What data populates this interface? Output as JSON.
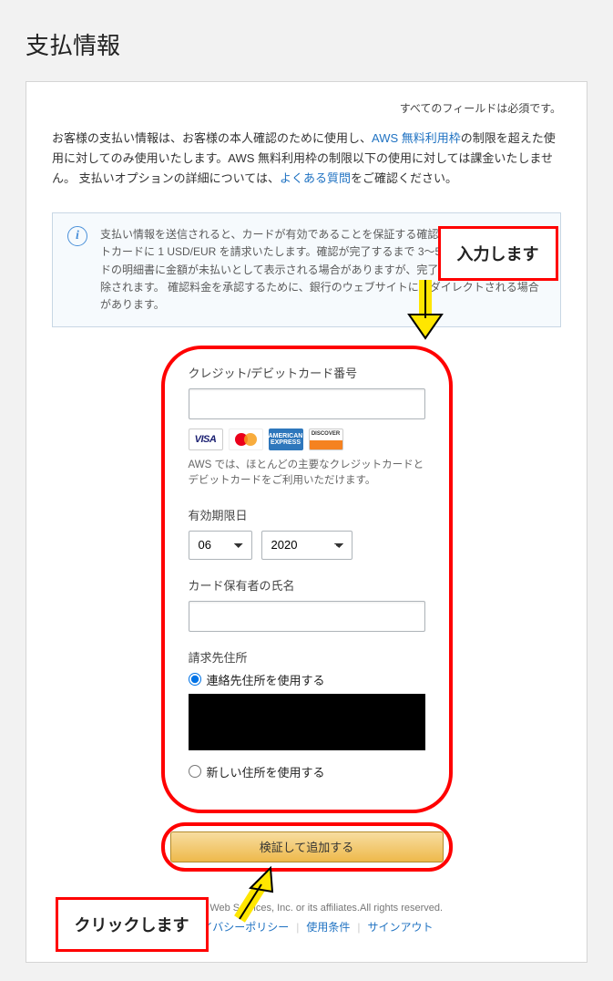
{
  "page": {
    "title": "支払情報",
    "required_note": "すべてのフィールドは必須です。"
  },
  "intro": {
    "part1": "お客様の支払い情報は、お客様の本人確認のために使用し、",
    "link1": "AWS 無料利用枠",
    "part2": "の制限を超えた使用に対してのみ使用いたします。AWS 無料利用枠の制限以下の使用に対しては課金いたしません。 支払いオプションの詳細については、",
    "link2": "よくある質問",
    "part3": "をご確認ください。"
  },
  "infobox": {
    "text": "支払い情報を送信されると、カードが有効であることを保証する確認料金としてクレジットカードに 1 USD/EUR を請求いたします。確認が完了するまで 3～5 日間クレジットカードの明細書に金額が未払いとして表示される場合がありますが、完了した時点で請求は削除されます。 確認料金を承認するために、銀行のウェブサイトにリダイレクトされる場合があります。"
  },
  "form": {
    "card_number_label": "クレジット/デビットカード番号",
    "card_number_value": "",
    "card_note": "AWS では、ほとんどの主要なクレジットカードとデビットカードをご利用いただけます。",
    "expiry_label": "有効期限日",
    "month_value": "06",
    "year_value": "2020",
    "cardholder_label": "カード保有者の氏名",
    "cardholder_value": "",
    "billing_label": "請求先住所",
    "radio_existing": "連絡先住所を使用する",
    "radio_new": "新しい住所を使用する"
  },
  "logos": {
    "visa": "VISA",
    "amex": "AMERICAN EXPRESS",
    "discover": "DISCOVER"
  },
  "button": {
    "submit": "検証して追加する"
  },
  "annotations": {
    "input": "入力します",
    "click": "クリックします"
  },
  "footer": {
    "copyright": "Amazon Web Services, Inc. or its affiliates.All rights reserved.",
    "privacy": "プライバシーポリシー",
    "terms": "使用条件",
    "signout": "サインアウト"
  }
}
